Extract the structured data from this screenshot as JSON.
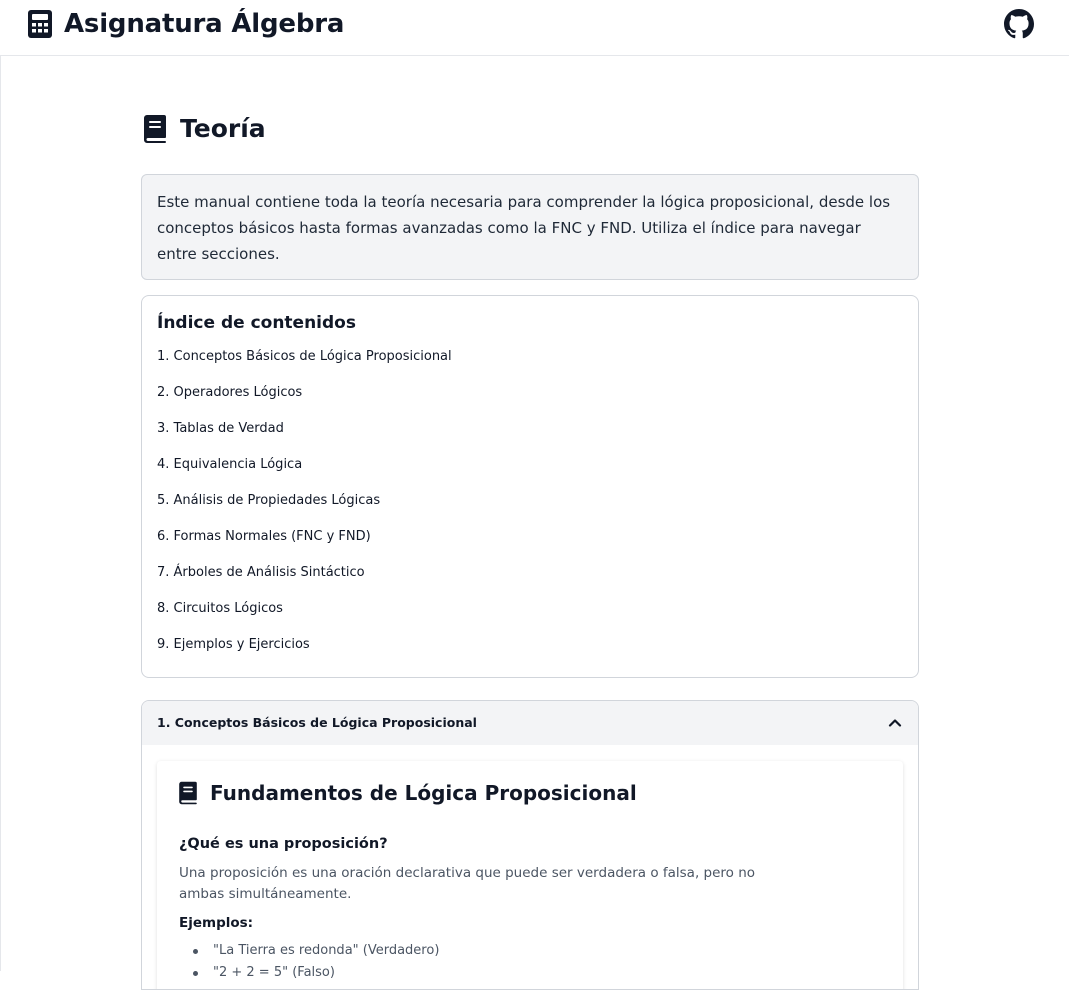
{
  "header": {
    "title": "Asignatura Álgebra",
    "brand_icon": "calculator-icon",
    "github_icon": "github-icon"
  },
  "page": {
    "title": "Teoría",
    "title_icon": "book-icon",
    "intro": "Este manual contiene toda la teoría necesaria para comprender la lógica proposicional, desde los conceptos básicos hasta formas avanzadas como la FNC y FND. Utiliza el índice para navegar entre secciones."
  },
  "toc": {
    "title": "Índice de contenidos",
    "items": [
      "1. Conceptos Básicos de Lógica Proposicional",
      "2. Operadores Lógicos",
      "3. Tablas de Verdad",
      "4. Equivalencia Lógica",
      "5. Análisis de Propiedades Lógicas",
      "6. Formas Normales (FNC y FND)",
      "7. Árboles de Análisis Sintáctico",
      "8. Circuitos Lógicos",
      "9. Ejemplos y Ejercicios"
    ]
  },
  "section1": {
    "header": "1. Conceptos Básicos de Lógica Proposicional",
    "expanded": true,
    "chevron_icon": "chevron-up-icon",
    "card": {
      "title": "Fundamentos de Lógica Proposicional",
      "subtitle": "¿Qué es una proposición?",
      "description": "Una proposición es una oración declarativa que puede ser verdadera o falsa, pero no ambas simultáneamente.",
      "examples_label": "Ejemplos:",
      "examples": [
        "\"La Tierra es redonda\" (Verdadero)",
        "\"2 + 2 = 5\" (Falso)"
      ]
    }
  },
  "colors": {
    "border": "#d1d5db",
    "panel_bg": "#f3f4f6",
    "text": "#111827",
    "muted": "#4b5563"
  }
}
